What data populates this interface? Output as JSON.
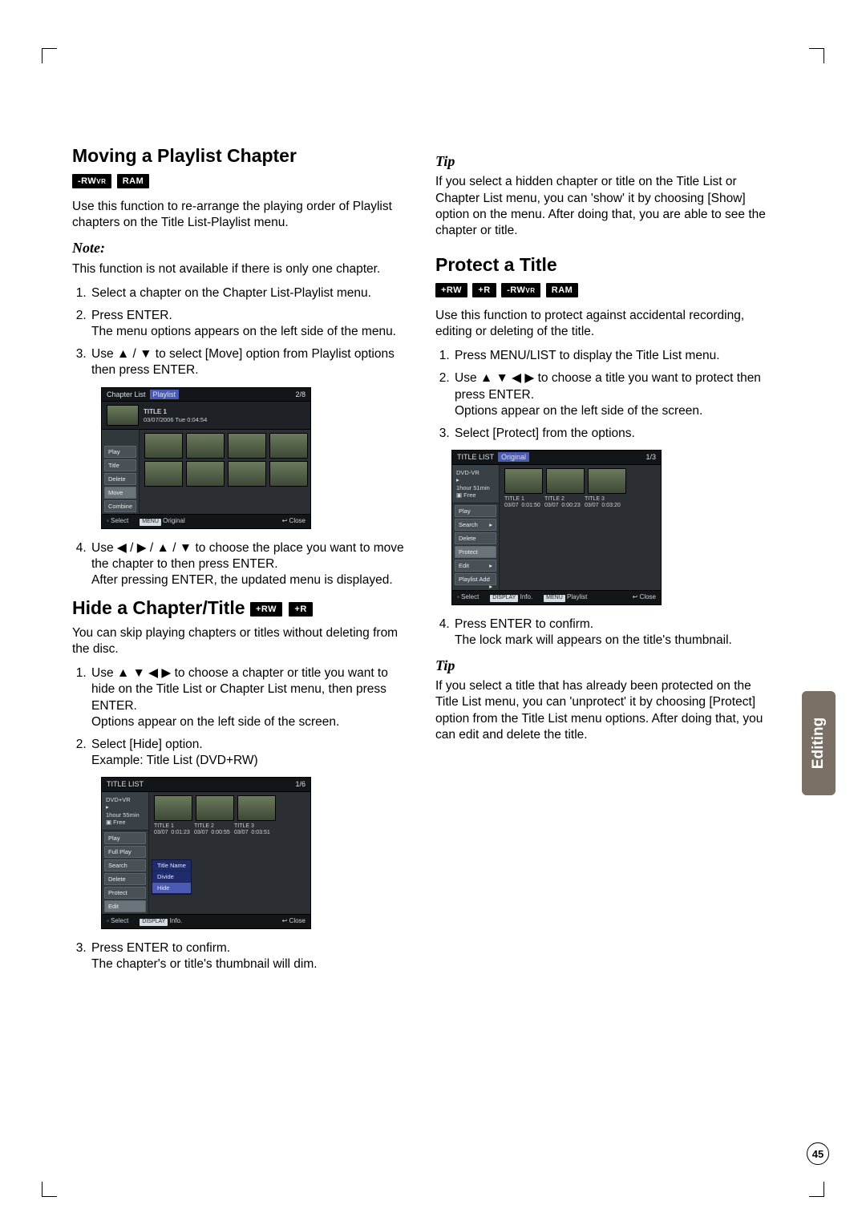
{
  "sidetab": "Editing",
  "pagenum": "45",
  "left": {
    "h1": "Moving a Playlist Chapter",
    "badges1": [
      "-RWVR",
      "RAM"
    ],
    "p1": "Use this function to re-arrange the playing order of Playlist chapters on the Title List-Playlist menu.",
    "note_label": "Note:",
    "note_text": "This function is not available if there is only one chapter.",
    "ol1": {
      "i1": "Select a chapter on the Chapter List-Playlist menu.",
      "i2a": "Press ENTER.",
      "i2b": "The menu options appears on the left side of the menu.",
      "i3": "Use ▲ / ▼ to select [Move] option from Playlist options then press ENTER.",
      "i4a": "Use ◀ / ▶ / ▲ / ▼ to choose the place you want to move the chapter to then press ENTER.",
      "i4b": "After pressing ENTER, the updated menu is displayed."
    },
    "h2": "Hide a Chapter/Title",
    "badges2": [
      "+RW",
      "+R"
    ],
    "p2": "You can skip playing chapters or titles without deleting from the disc.",
    "ol2": {
      "i1a": "Use ▲ ▼ ◀ ▶ to choose a chapter or title you want to hide on the Title List or Chapter List menu, then press ENTER.",
      "i1b": "Options appear on the left side of the screen.",
      "i2a": "Select [Hide] option.",
      "i2b": "Example: Title List (DVD+RW)",
      "i3a": "Press ENTER to confirm.",
      "i3b": "The chapter's or title's thumbnail will dim."
    }
  },
  "right": {
    "tip1_label": "Tip",
    "tip1_text": "If you select a hidden chapter or title on the Title List or Chapter List menu, you can 'show' it by choosing [Show] option on the menu. After doing that, you are able to see the chapter or title.",
    "h1": "Protect a Title",
    "badges1": [
      "+RW",
      "+R",
      "-RWVR",
      "RAM"
    ],
    "p1": "Use this function to protect against accidental recording, editing or deleting of the title.",
    "ol1": {
      "i1": "Press MENU/LIST to display the Title List menu.",
      "i2a": "Use ▲ ▼ ◀ ▶ to choose a title you want to protect then press ENTER.",
      "i2b": "Options appear on the left side of the screen.",
      "i3": "Select [Protect] from the options.",
      "i4a": "Press ENTER to confirm.",
      "i4b": "The lock mark will appears on the title's thumbnail."
    },
    "tip2_label": "Tip",
    "tip2_text": "If you select a title that has already been protected on the Title List menu, you can 'unprotect' it by choosing [Protect] option from the Title List menu options. After doing that, you can edit and delete the title."
  },
  "shot1": {
    "title_left": "Chapter List",
    "title_mid": "Playlist",
    "title_right": "2/8",
    "header_title": "TITLE 1",
    "header_date": "03/07/2006 Tue  0:04:54",
    "sidebar": [
      "Play",
      "Title",
      "Delete",
      "Move",
      "Combine"
    ],
    "footer": {
      "a": "◦ Select",
      "b": "MENU Original",
      "c": "↩ Close"
    }
  },
  "shot2": {
    "title_left": "TITLE LIST",
    "title_right": "1/6",
    "info": {
      "l1": "DVD+VR",
      "l2": "1hour 55min",
      "l3": "▣ Free"
    },
    "sidebar": [
      "Play",
      "Full Play",
      "Search",
      "Delete",
      "Protect",
      "Edit"
    ],
    "submenu": [
      "Title Name",
      "Divide",
      "Hide"
    ],
    "titles": [
      {
        "name": "TITLE 1",
        "date": "03/07",
        "dur": "0:01:23"
      },
      {
        "name": "TITLE 2",
        "date": "03/07",
        "dur": "0:00:55"
      },
      {
        "name": "TITLE 3",
        "date": "03/07",
        "dur": "0:03:51"
      }
    ],
    "footer": {
      "a": "◦ Select",
      "b": "DISPLAY Info.",
      "c": "↩ Close"
    }
  },
  "shot3": {
    "title_left": "TITLE LIST",
    "title_mid": "Original",
    "title_right": "1/3",
    "info": {
      "l1": "DVD-VR",
      "l2": "1hour 51min",
      "l3": "▣ Free"
    },
    "sidebar": [
      "Play",
      "Search",
      "Delete",
      "Protect",
      "Edit",
      "Playlist Add"
    ],
    "titles": [
      {
        "name": "TITLE 1",
        "date": "03/07",
        "dur": "0:01:50"
      },
      {
        "name": "TITLE 2",
        "date": "03/07",
        "dur": "0:00:23"
      },
      {
        "name": "TITLE 3",
        "date": "03/07",
        "dur": "0:03:20"
      }
    ],
    "footer": {
      "a": "◦ Select",
      "b": "DISPLAY Info.",
      "c": "MENU Playlist",
      "d": "↩ Close"
    }
  }
}
